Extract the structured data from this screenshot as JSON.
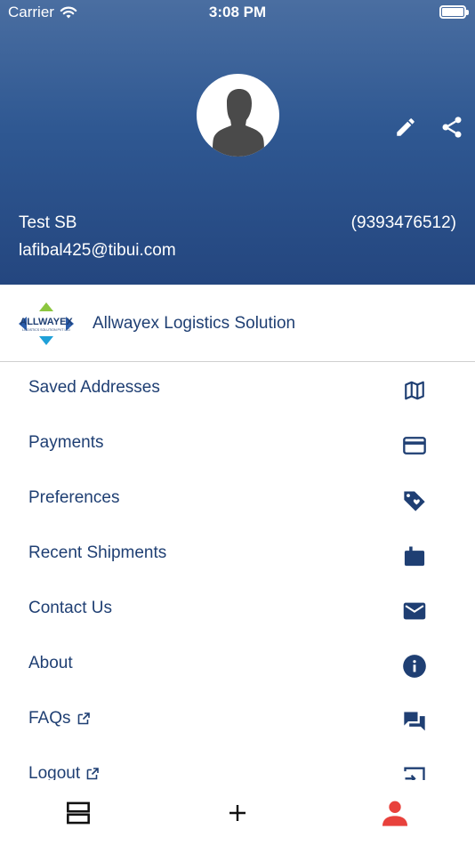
{
  "status_bar": {
    "carrier": "Carrier",
    "time": "3:08 PM"
  },
  "profile": {
    "name": "Test SB",
    "phone": "(9393476512)",
    "email": "lafibal425@tibui.com",
    "avatar_icon": "person-silhouette-icon",
    "actions": [
      {
        "icon": "pencil-icon"
      },
      {
        "icon": "share-icon"
      }
    ]
  },
  "company": {
    "logo_text": "ALLWAYEX",
    "logo_subtext": "LOGISTICS SOLUTION PVT LTD",
    "name": "Allwayex Logistics Solution"
  },
  "menu": {
    "items": [
      {
        "label": "Saved Addresses",
        "icon": "map-icon",
        "external": false
      },
      {
        "label": "Payments",
        "icon": "credit-card-icon",
        "external": false
      },
      {
        "label": "Preferences",
        "icon": "tag-heart-icon",
        "external": false
      },
      {
        "label": "Recent Shipments",
        "icon": "shipment-box-icon",
        "external": false
      },
      {
        "label": "Contact Us",
        "icon": "mail-icon",
        "external": false
      },
      {
        "label": "About",
        "icon": "info-icon",
        "external": false
      },
      {
        "label": "FAQs",
        "icon": "chat-bubbles-icon",
        "external": true
      },
      {
        "label": "Logout",
        "icon": "logout-icon",
        "external": true
      }
    ]
  },
  "tabbar": {
    "tabs": [
      {
        "icon": "list-icon",
        "active": false
      },
      {
        "icon": "add-icon",
        "active": false
      },
      {
        "icon": "profile-icon",
        "active": true
      }
    ]
  },
  "colors": {
    "header_top": "#4a6ea1",
    "header_bottom": "#24467f",
    "text_primary": "#1f3f73",
    "icon": "#1f3f73",
    "active_tab": "#e8413c"
  }
}
